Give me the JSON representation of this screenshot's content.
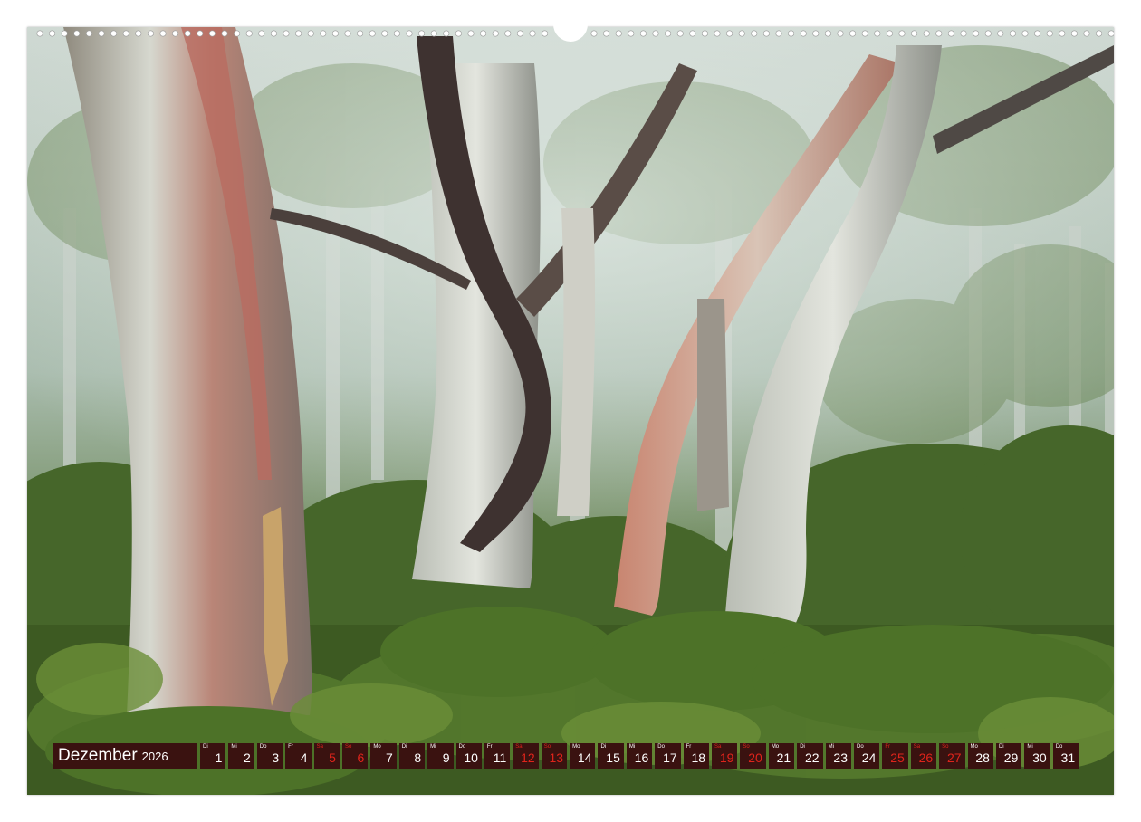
{
  "image": {
    "subject": "misty eucalyptus snow gum forest with green undergrowth",
    "colors": {
      "foliage": "#4e6b2f",
      "mist": "#b8c8c0",
      "bark": "#d9ddd6",
      "bark_red": "#b86a5c"
    }
  },
  "calendar": {
    "month": "Dezember",
    "year": "2026",
    "colors": {
      "box": "#3a1210",
      "text": "#ffffff",
      "weekend": "#e0241b"
    },
    "days": [
      {
        "n": "1",
        "wd": "Di",
        "weekend": false
      },
      {
        "n": "2",
        "wd": "Mi",
        "weekend": false
      },
      {
        "n": "3",
        "wd": "Do",
        "weekend": false
      },
      {
        "n": "4",
        "wd": "Fr",
        "weekend": false
      },
      {
        "n": "5",
        "wd": "Sa",
        "weekend": true
      },
      {
        "n": "6",
        "wd": "So",
        "weekend": true
      },
      {
        "n": "7",
        "wd": "Mo",
        "weekend": false
      },
      {
        "n": "8",
        "wd": "Di",
        "weekend": false
      },
      {
        "n": "9",
        "wd": "Mi",
        "weekend": false
      },
      {
        "n": "10",
        "wd": "Do",
        "weekend": false
      },
      {
        "n": "11",
        "wd": "Fr",
        "weekend": false
      },
      {
        "n": "12",
        "wd": "Sa",
        "weekend": true
      },
      {
        "n": "13",
        "wd": "So",
        "weekend": true
      },
      {
        "n": "14",
        "wd": "Mo",
        "weekend": false
      },
      {
        "n": "15",
        "wd": "Di",
        "weekend": false
      },
      {
        "n": "16",
        "wd": "Mi",
        "weekend": false
      },
      {
        "n": "17",
        "wd": "Do",
        "weekend": false
      },
      {
        "n": "18",
        "wd": "Fr",
        "weekend": false
      },
      {
        "n": "19",
        "wd": "Sa",
        "weekend": true
      },
      {
        "n": "20",
        "wd": "So",
        "weekend": true
      },
      {
        "n": "21",
        "wd": "Mo",
        "weekend": false
      },
      {
        "n": "22",
        "wd": "Di",
        "weekend": false
      },
      {
        "n": "23",
        "wd": "Mi",
        "weekend": false
      },
      {
        "n": "24",
        "wd": "Do",
        "weekend": false
      },
      {
        "n": "25",
        "wd": "Fr",
        "weekend": true
      },
      {
        "n": "26",
        "wd": "Sa",
        "weekend": true
      },
      {
        "n": "27",
        "wd": "So",
        "weekend": true
      },
      {
        "n": "28",
        "wd": "Mo",
        "weekend": false
      },
      {
        "n": "29",
        "wd": "Di",
        "weekend": false
      },
      {
        "n": "30",
        "wd": "Mi",
        "weekend": false
      },
      {
        "n": "31",
        "wd": "Do",
        "weekend": false
      }
    ]
  }
}
